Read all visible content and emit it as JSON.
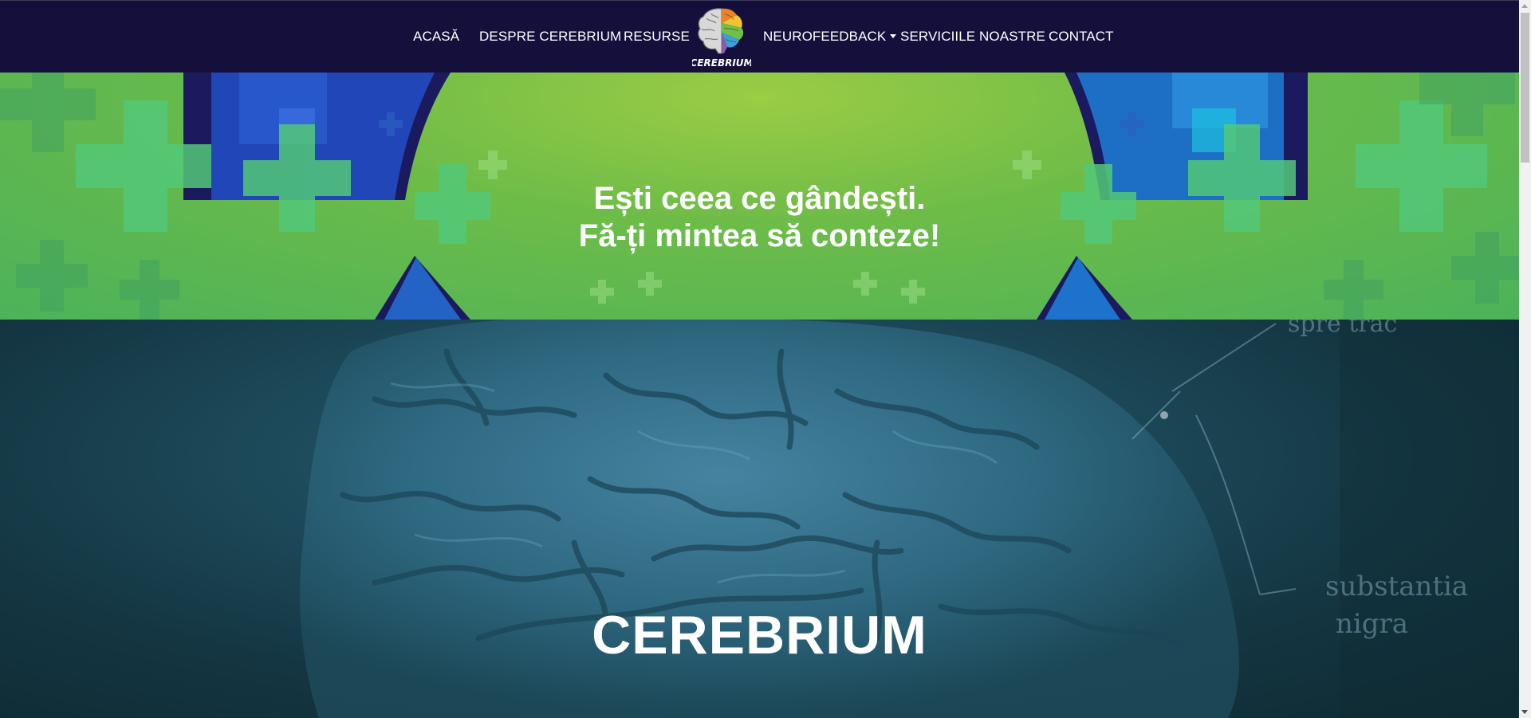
{
  "nav": {
    "items": [
      {
        "label": "ACASĂ"
      },
      {
        "label": "DESPRE CEREBRIUM"
      },
      {
        "label": "RESURSE"
      },
      {
        "label": "NEUROFEEDBACK"
      },
      {
        "label": "SERVICIILE NOASTRE"
      },
      {
        "label": "CONTACT"
      }
    ],
    "logo_text": "CEREBRIUM",
    "logo_icon": "brain-logo-icon"
  },
  "hero": {
    "line1": "Ești ceea ce gândești.",
    "line2": "Fă-ți mintea să conteze!"
  },
  "video_section": {
    "title": "CEREBRIUM",
    "overlay_words": [
      "spre trac",
      "substantia",
      "nigra"
    ]
  },
  "colors": {
    "navbar": "#150f3c",
    "hero_green": "#6dbc48",
    "hero_blue": "#1e5fb8",
    "video_teal": "#1d4a5a"
  }
}
